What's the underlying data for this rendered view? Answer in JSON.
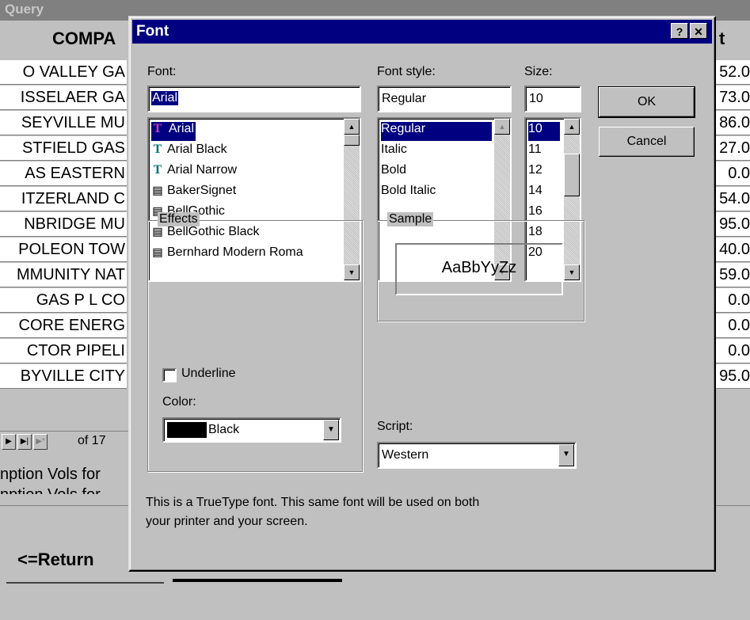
{
  "background": {
    "window_title": "Query",
    "header_left": "COMPA",
    "header_right": "t",
    "rows_left": [
      "O VALLEY GA",
      "ISSELAER GA",
      "SEYVILLE MU",
      "STFIELD GAS",
      "AS EASTERN",
      "ITZERLAND C",
      "NBRIDGE MU",
      "POLEON TOW",
      "MMUNITY NAT",
      "GAS P L CO",
      "CORE ENERG",
      "CTOR PIPELI",
      "BYVILLE CITY"
    ],
    "rows_right": [
      "52.0",
      "73.0",
      "86.0",
      "27.0",
      "0.0",
      "54.0",
      "95.0",
      "40.0",
      "59.0",
      "0.0",
      "0.0",
      "0.0",
      "95.0"
    ],
    "nav_of": "of 17",
    "note1": "nption Vols for",
    "note2": "nption Vols for",
    "return_button": "<=Return"
  },
  "dialog": {
    "title": "Font",
    "help_button": "?",
    "close_button": "✕",
    "font_label": "Font:",
    "font_value": "Arial",
    "fonts": [
      {
        "name": "Arial",
        "icon": "truetype-icon",
        "selected": true
      },
      {
        "name": "Arial Black",
        "icon": "truetype-icon",
        "selected": false
      },
      {
        "name": "Arial Narrow",
        "icon": "truetype-icon",
        "selected": false
      },
      {
        "name": "BakerSignet",
        "icon": "printer-font-icon",
        "selected": false
      },
      {
        "name": "BellGothic",
        "icon": "printer-font-icon",
        "selected": false
      },
      {
        "name": "BellGothic Black",
        "icon": "printer-font-icon",
        "selected": false
      },
      {
        "name": "Bernhard Modern Roma",
        "icon": "printer-font-icon",
        "selected": false
      }
    ],
    "style_label": "Font style:",
    "style_value": "Regular",
    "styles": [
      {
        "name": "Regular",
        "selected": true
      },
      {
        "name": "Italic",
        "selected": false
      },
      {
        "name": "Bold",
        "selected": false
      },
      {
        "name": "Bold Italic",
        "selected": false
      }
    ],
    "size_label": "Size:",
    "size_value": "10",
    "sizes": [
      {
        "name": "10",
        "selected": true
      },
      {
        "name": "11",
        "selected": false
      },
      {
        "name": "12",
        "selected": false
      },
      {
        "name": "14",
        "selected": false
      },
      {
        "name": "16",
        "selected": false
      },
      {
        "name": "18",
        "selected": false
      },
      {
        "name": "20",
        "selected": false
      }
    ],
    "ok_button": "OK",
    "cancel_button": "Cancel",
    "effects_label": "Effects",
    "underline_label": "Underline",
    "underline_checked": false,
    "color_label": "Color:",
    "color_value": "Black",
    "color_swatch": "#000000",
    "sample_label": "Sample",
    "sample_text": "AaBbYyZz",
    "script_label": "Script:",
    "script_value": "Western",
    "info_text_line1": "This is a TrueType font. This same font will be used on both",
    "info_text_line2": "your printer and your screen."
  }
}
